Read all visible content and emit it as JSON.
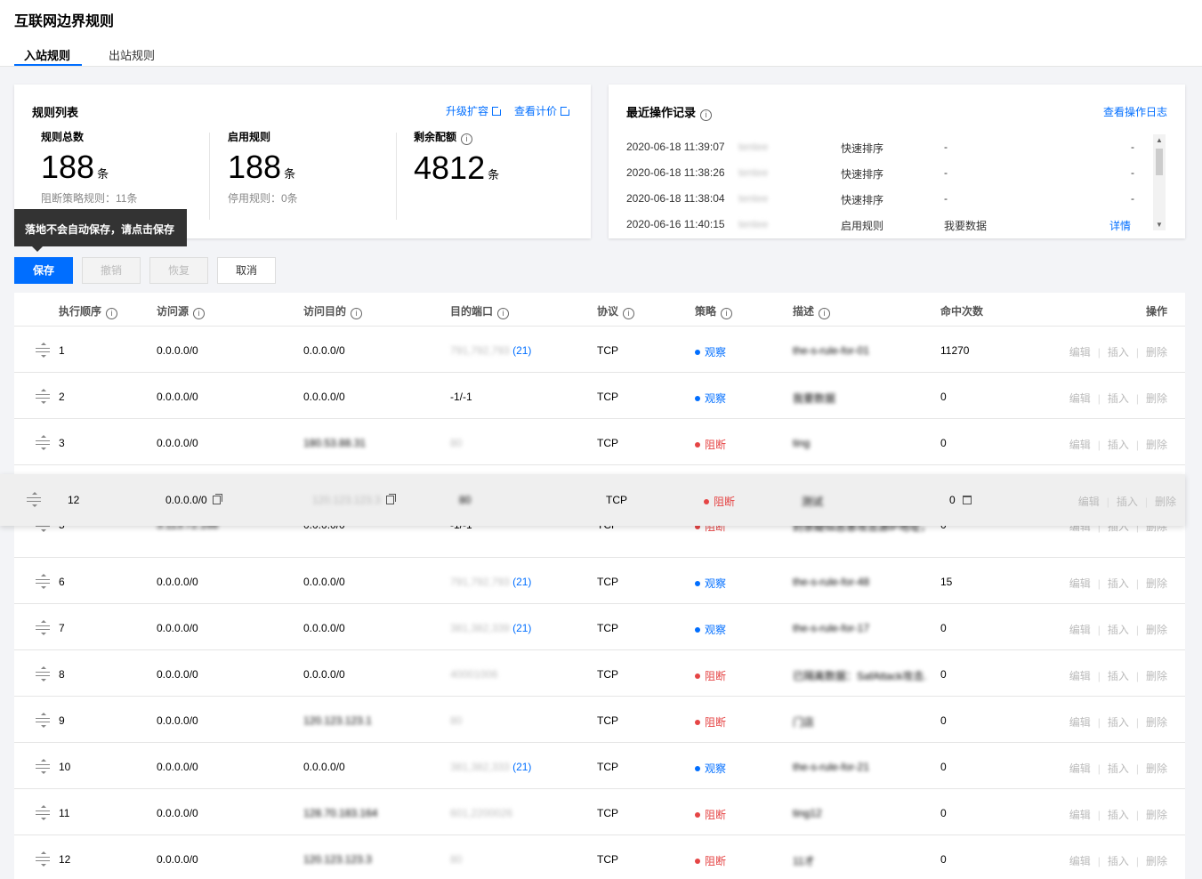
{
  "page": {
    "title": "互联网边界规则"
  },
  "tabs": [
    {
      "label": "入站规则",
      "active": true
    },
    {
      "label": "出站规则",
      "active": false
    }
  ],
  "rules_card": {
    "title": "规则列表",
    "links": [
      "升级扩容",
      "查看计价"
    ],
    "stats": [
      {
        "label": "规则总数",
        "value": "188",
        "unit": "条",
        "sub": "阻断策略规则：11条"
      },
      {
        "label": "启用规则",
        "value": "188",
        "unit": "条",
        "sub": "停用规则：0条"
      },
      {
        "label": "剩余配额",
        "value": "4812",
        "unit": "条",
        "sub": ""
      }
    ]
  },
  "log_card": {
    "title": "最近操作记录",
    "link": "查看操作日志",
    "rows": [
      {
        "time": "2020-06-18 11:39:07",
        "user": "tentee",
        "action": "快速排序",
        "target": "-",
        "detail": "-"
      },
      {
        "time": "2020-06-18 11:38:26",
        "user": "tentee",
        "action": "快速排序",
        "target": "-",
        "detail": "-"
      },
      {
        "time": "2020-06-18 11:38:04",
        "user": "tentee",
        "action": "快速排序",
        "target": "-",
        "detail": "-"
      },
      {
        "time": "2020-06-16 11:40:15",
        "user": "tentee",
        "action": "启用规则",
        "target": "我要数据",
        "detail": "详情"
      }
    ]
  },
  "tooltip": {
    "text": "落地不会自动保存，请点击保存"
  },
  "toolbar": {
    "save": "保存",
    "undo": "撤销",
    "redo": "恢复",
    "cancel": "取消"
  },
  "table": {
    "headers": [
      "执行顺序",
      "访问源",
      "访问目的",
      "目的端口",
      "协议",
      "策略",
      "描述",
      "命中次数",
      "操作"
    ],
    "ops": [
      "编辑",
      "插入",
      "删除"
    ],
    "rows": [
      {
        "order": "1",
        "src": "0.0.0.0/0",
        "dst": "0.0.0.0/0",
        "port": "791,792,793",
        "port_count": "(21)",
        "proto": "TCP",
        "policy": "观察",
        "desc": "the-s-rule-for-01",
        "hits": "11270"
      },
      {
        "order": "2",
        "src": "0.0.0.0/0",
        "dst": "0.0.0.0/0",
        "port": "-1/-1",
        "port_count": "",
        "proto": "TCP",
        "policy": "观察",
        "desc": "我要数据",
        "hits": "0"
      },
      {
        "order": "3",
        "src": "0.0.0.0/0",
        "dst": "180.53.88.31",
        "port": "80",
        "port_count": "",
        "proto": "TCP",
        "policy": "阻断",
        "desc": "ting",
        "hits": "0"
      },
      {
        "order": "5",
        "src": "3.113.72.168",
        "dst": "0.0.0.0/0",
        "port": "-1/-1",
        "port_count": "",
        "proto": "TCP",
        "policy": "阻断",
        "desc": "封禁疑似恶意攻击源IP地址，根...",
        "hits": "0"
      },
      {
        "order": "6",
        "src": "0.0.0.0/0",
        "dst": "0.0.0.0/0",
        "port": "791,792,793",
        "port_count": "(21)",
        "proto": "TCP",
        "policy": "观察",
        "desc": "the-s-rule-for-48",
        "hits": "15"
      },
      {
        "order": "7",
        "src": "0.0.0.0/0",
        "dst": "0.0.0.0/0",
        "port": "381,382,339",
        "port_count": "(21)",
        "proto": "TCP",
        "policy": "观察",
        "desc": "the-s-rule-for-17",
        "hits": "0"
      },
      {
        "order": "8",
        "src": "0.0.0.0/0",
        "dst": "0.0.0.0/0",
        "port": "40001006",
        "port_count": "",
        "proto": "TCP",
        "policy": "阻断",
        "desc": "已隔离数据：SafAttack攻击...",
        "hits": "0"
      },
      {
        "order": "9",
        "src": "0.0.0.0/0",
        "dst": "120.123.123.1",
        "port": "80",
        "port_count": "",
        "proto": "TCP",
        "policy": "阻断",
        "desc": "门店",
        "hits": "0"
      },
      {
        "order": "10",
        "src": "0.0.0.0/0",
        "dst": "0.0.0.0/0",
        "port": "381,382,333",
        "port_count": "(21)",
        "proto": "TCP",
        "policy": "观察",
        "desc": "the-s-rule-for-21",
        "hits": "0"
      },
      {
        "order": "11",
        "src": "0.0.0.0/0",
        "dst": "128.70.183.164",
        "port": "601,2200026",
        "port_count": "",
        "proto": "TCP",
        "policy": "阻断",
        "desc": "ting12",
        "hits": "0"
      },
      {
        "order": "12",
        "src": "0.0.0.0/0",
        "dst": "120.123.123.3",
        "port": "80",
        "port_count": "",
        "proto": "TCP",
        "policy": "阻断",
        "desc": "11才",
        "hits": "0"
      }
    ],
    "dragging_row": {
      "order": "12",
      "src": "0.0.0.0/0",
      "dst": "120.123.123.3",
      "port": "80",
      "proto": "TCP",
      "policy": "阻断",
      "desc": "测试",
      "hits": "0"
    }
  },
  "colors": {
    "accent": "#006eff",
    "observe": "#006eff",
    "block": "#e54545"
  }
}
